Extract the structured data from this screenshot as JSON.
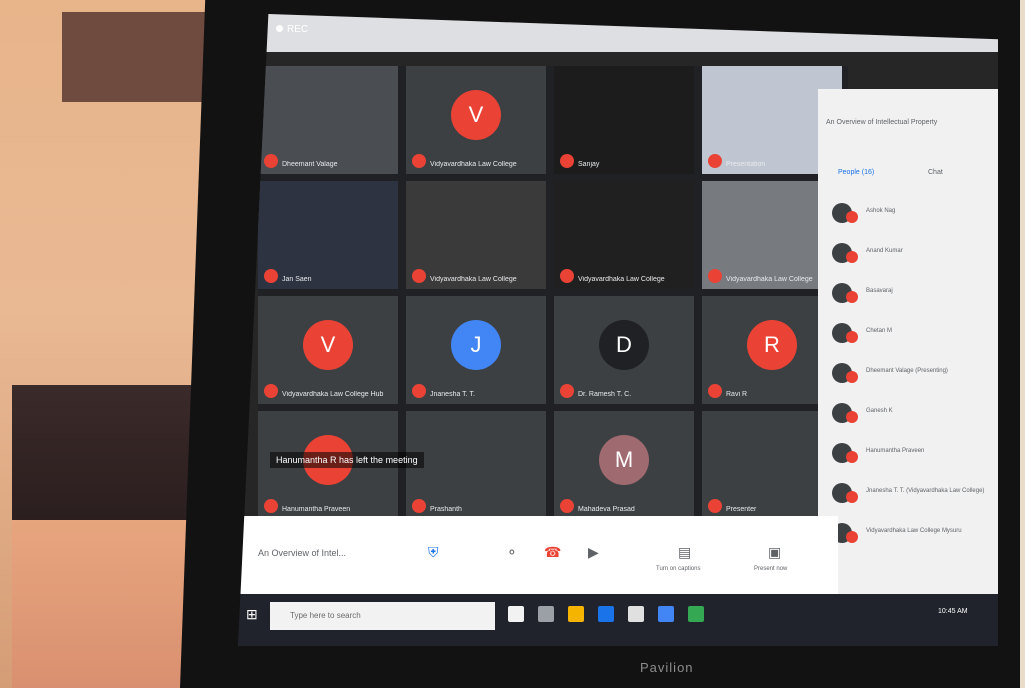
{
  "recording": {
    "label": "REC"
  },
  "brand": {
    "label": "Pavilion"
  },
  "grid": {
    "tiles": [
      {
        "kind": "video",
        "initial": "",
        "name": "Dheemant Valage",
        "bg": "#4a4d52"
      },
      {
        "kind": "avatar",
        "initial": "V",
        "name": "Vidyavardhaka Law College",
        "avatar_color": "#ea4335"
      },
      {
        "kind": "video",
        "initial": "",
        "name": "Sanjay",
        "bg": "#1c1c1c"
      },
      {
        "kind": "video",
        "initial": "",
        "name": "Presentation",
        "bg": "#c0c6d1"
      },
      {
        "kind": "video",
        "initial": "",
        "name": "Jan Saen",
        "bg": "#2d3340"
      },
      {
        "kind": "video",
        "initial": "",
        "name": "Vidyavardhaka Law College",
        "bg": "#3a3a3a"
      },
      {
        "kind": "video",
        "initial": "",
        "name": "Vidyavardhaka Law College",
        "bg": "#202020"
      },
      {
        "kind": "video",
        "initial": "",
        "name": "Vidyavardhaka Law College",
        "bg": "#777a7f"
      },
      {
        "kind": "avatar",
        "initial": "V",
        "name": "Vidyavardhaka Law College Hub",
        "avatar_color": "#ea4335"
      },
      {
        "kind": "avatar",
        "initial": "J",
        "name": "Jnanesha T. T.",
        "avatar_color": "#4285f4"
      },
      {
        "kind": "avatar",
        "initial": "D",
        "name": "Dr. Ramesh T. C.",
        "avatar_color": "#202124"
      },
      {
        "kind": "avatar",
        "initial": "R",
        "name": "Ravi R",
        "avatar_color": "#ea4335"
      },
      {
        "kind": "avatar",
        "initial": "",
        "name": "Hanumantha Praveen",
        "avatar_color": "#ea4335"
      },
      {
        "kind": "video",
        "initial": "",
        "name": "Prashanth",
        "bg": "#3c4043"
      },
      {
        "kind": "avatar",
        "initial": "M",
        "name": "Mahadeva Prasad",
        "avatar_color": "#a06b70"
      },
      {
        "kind": "video",
        "initial": "",
        "name": "Presenter",
        "bg": "#3c4043"
      }
    ],
    "toast": "Hanumantha R has left the meeting"
  },
  "side_panel": {
    "title": "An Overview of Intellectual Property",
    "tabs": [
      "People (16)",
      "Chat"
    ],
    "people": [
      {
        "name": "Ashok Nag"
      },
      {
        "name": "Anand Kumar"
      },
      {
        "name": "Basavaraj"
      },
      {
        "name": "Chetan M"
      },
      {
        "name": "Dheemant Valage (Presenting)"
      },
      {
        "name": "Ganesh K"
      },
      {
        "name": "Hanumantha Praveen"
      },
      {
        "name": "Jnanesha T. T. (Vidyavardhaka Law College)"
      },
      {
        "name": "Vidyavardhaka Law College Mysuru"
      }
    ]
  },
  "controls": {
    "meeting_name": "An Overview of Intel...",
    "turn_on_captions": "Turn on captions",
    "present_now": "Present now"
  },
  "taskbar": {
    "search_placeholder": "Type here to search",
    "clock": "10:45 AM"
  }
}
